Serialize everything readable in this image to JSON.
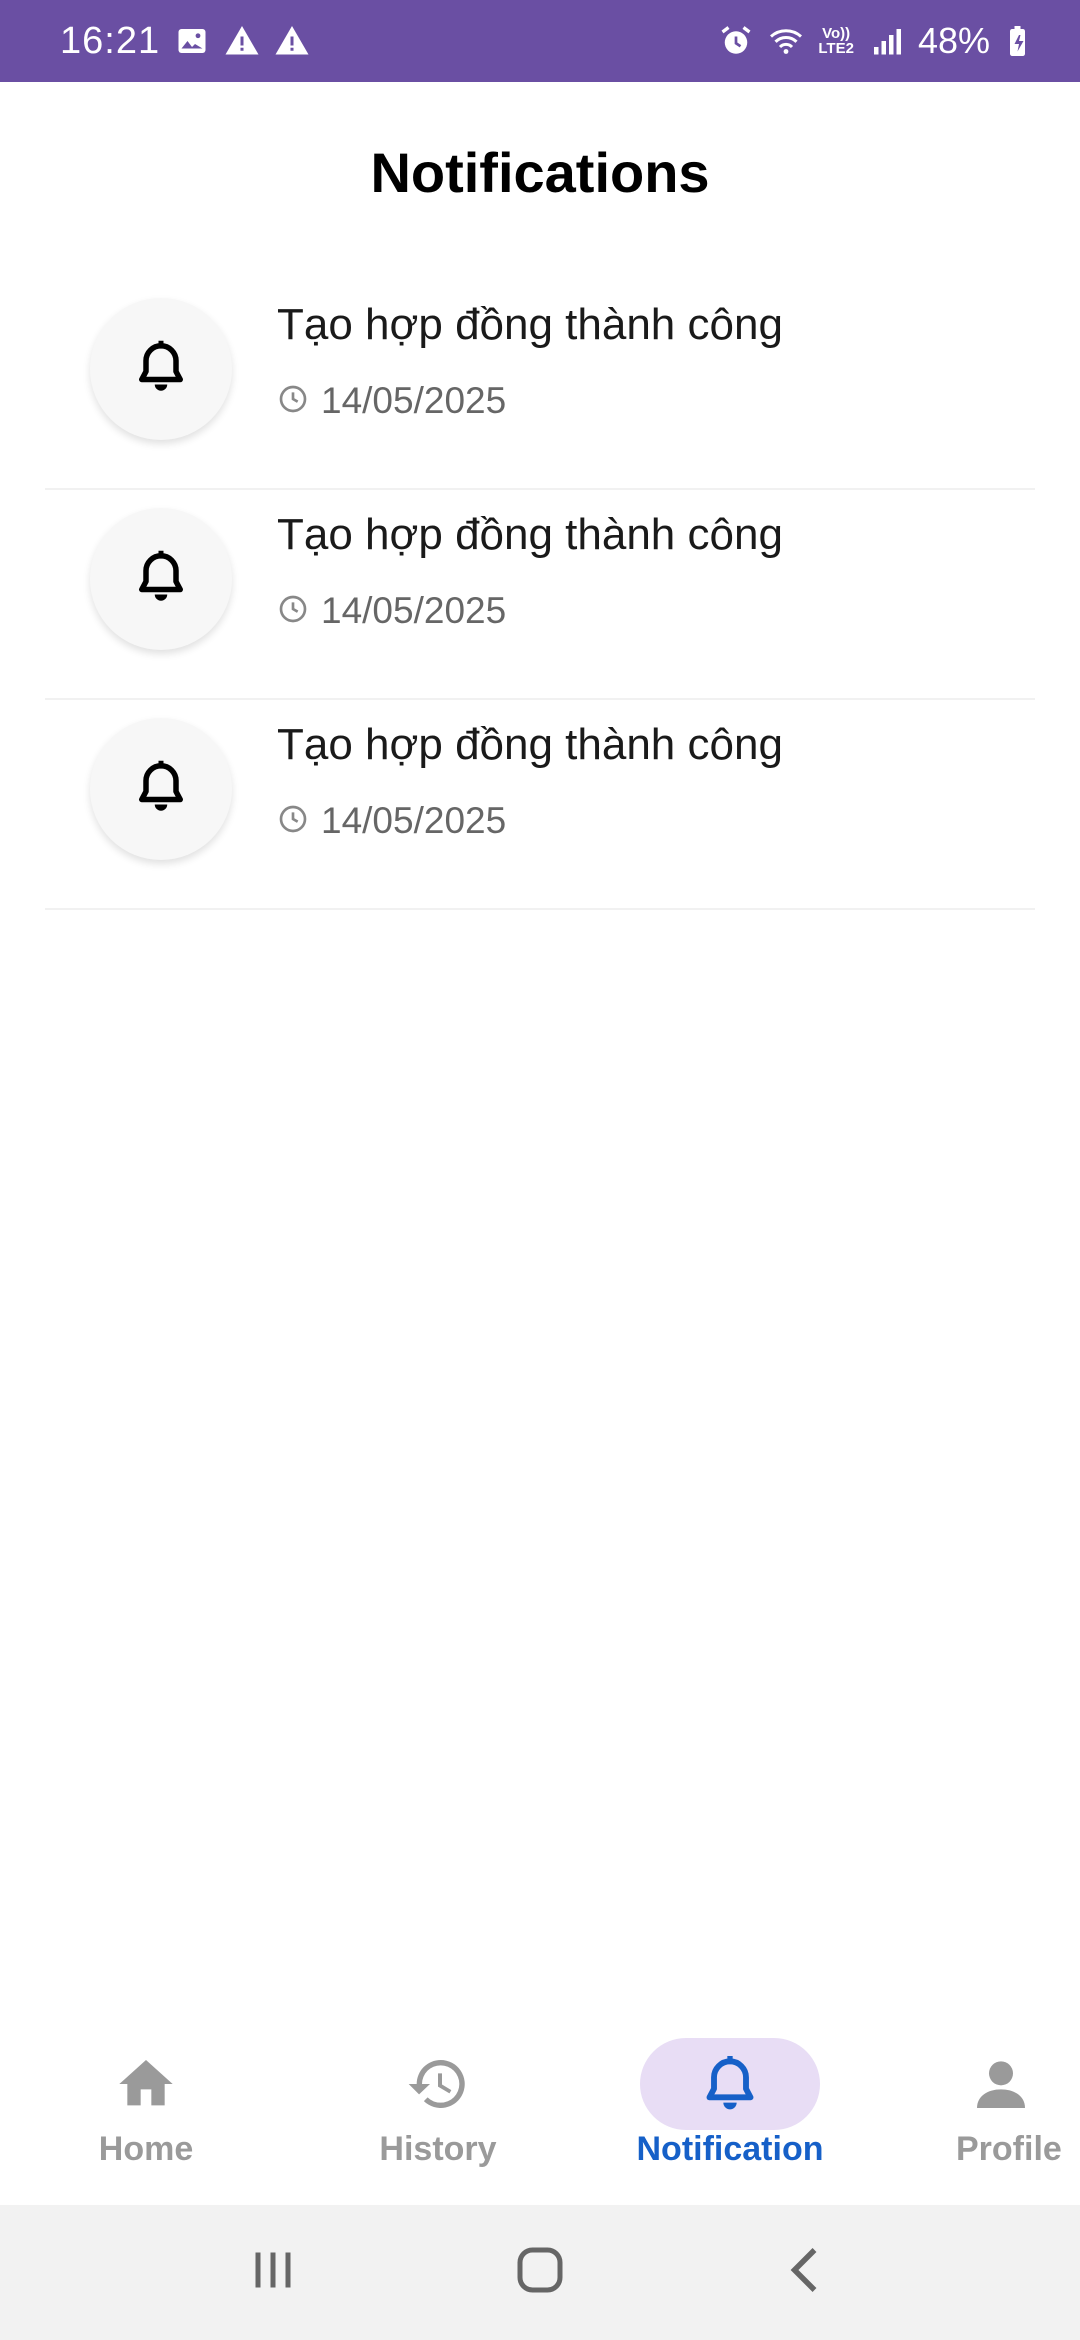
{
  "status_bar": {
    "time": "16:21",
    "battery": "48%",
    "network_label": "Vo))\nLTE2",
    "icons": [
      "image-icon",
      "warning-icon",
      "warning-icon",
      "alarm-icon",
      "wifi-icon",
      "signal-icon",
      "battery-icon"
    ],
    "color": "#6a4fa3"
  },
  "header": {
    "title": "Notifications"
  },
  "notifications": [
    {
      "title": "Tạo hợp đồng thành công",
      "date": "14/05/2025",
      "icon": "bell-icon"
    },
    {
      "title": "Tạo hợp đồng thành công",
      "date": "14/05/2025",
      "icon": "bell-icon"
    },
    {
      "title": "Tạo hợp đồng thành công",
      "date": "14/05/2025",
      "icon": "bell-icon"
    }
  ],
  "bottom_nav": {
    "active": "notification",
    "accent_color": "#1660c8",
    "pill_color": "#e8ddf5",
    "items": [
      {
        "id": "home",
        "label": "Home",
        "icon": "home-icon"
      },
      {
        "id": "history",
        "label": "History",
        "icon": "history-icon"
      },
      {
        "id": "notification",
        "label": "Notification",
        "icon": "bell-icon"
      },
      {
        "id": "profile",
        "label": "Profile",
        "icon": "person-icon"
      }
    ]
  },
  "system_nav": {
    "buttons": [
      "recent-apps-icon",
      "home-circle-icon",
      "back-icon"
    ]
  }
}
